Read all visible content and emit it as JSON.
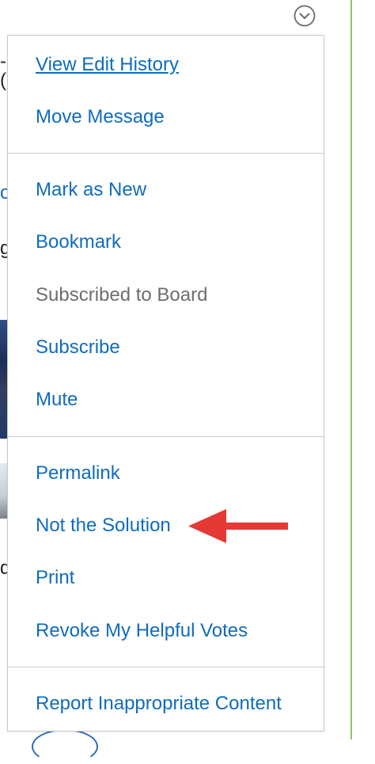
{
  "menu": {
    "items": [
      {
        "label": "View Edit History",
        "state": "link"
      },
      {
        "label": "Move Message",
        "state": "link"
      },
      {
        "label": "Mark as New",
        "state": "link"
      },
      {
        "label": "Bookmark",
        "state": "link"
      },
      {
        "label": "Subscribed to Board",
        "state": "disabled"
      },
      {
        "label": "Subscribe",
        "state": "link"
      },
      {
        "label": "Mute",
        "state": "link"
      },
      {
        "label": "Permalink",
        "state": "link"
      },
      {
        "label": "Not the Solution",
        "state": "link",
        "highlighted": true
      },
      {
        "label": "Print",
        "state": "link"
      },
      {
        "label": "Revoke My Helpful Votes",
        "state": "link"
      },
      {
        "label": "Report Inappropriate Content",
        "state": "link"
      }
    ]
  },
  "toggle_icon": "chevron-down-circle-icon",
  "annotation": {
    "type": "arrow",
    "points_to": "Not the Solution",
    "color": "#e53935"
  },
  "colors": {
    "link": "#0f6cbd",
    "disabled": "#6e6e6e",
    "divider": "#c9c9c9",
    "accent_rule": "#8cc56a",
    "arrow": "#e53935"
  },
  "background_fragments": {
    "frag_top": "-(",
    "frag_link": "o",
    "frag_mid": "g",
    "frag_low": "d"
  }
}
